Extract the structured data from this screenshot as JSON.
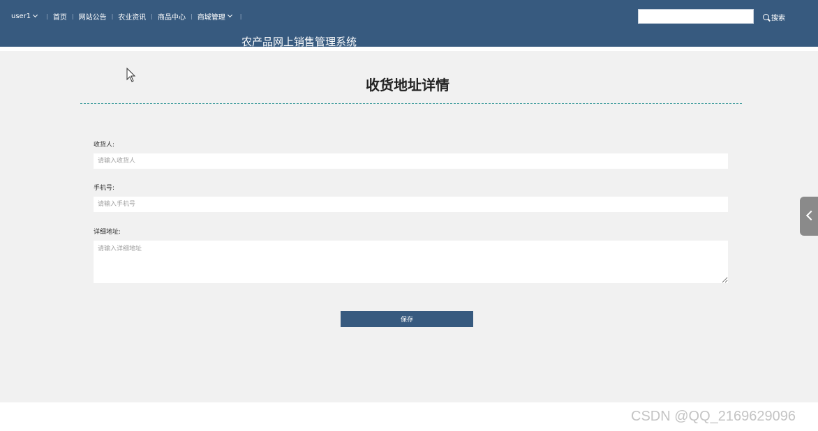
{
  "nav": {
    "user": "user1",
    "items": [
      "首页",
      "网站公告",
      "农业资讯",
      "商品中心",
      "商城管理"
    ],
    "separator": "|"
  },
  "site_title": "农产品网上销售管理系统",
  "search": {
    "value": "",
    "button_label": "搜索"
  },
  "page": {
    "heading": "收货地址详情",
    "fields": [
      {
        "label": "收货人:",
        "placeholder": "请输入收货人",
        "value": ""
      },
      {
        "label": "手机号:",
        "placeholder": "请输入手机号",
        "value": ""
      },
      {
        "label": "详细地址:",
        "placeholder": "请输入详细地址",
        "value": ""
      }
    ],
    "save_label": "保存"
  },
  "watermark": "CSDN @QQ_2169629096",
  "colors": {
    "topbar": "#375a7f",
    "background": "#f1f1f1",
    "divider": "#3a9a9a",
    "button": "#375a7f"
  }
}
